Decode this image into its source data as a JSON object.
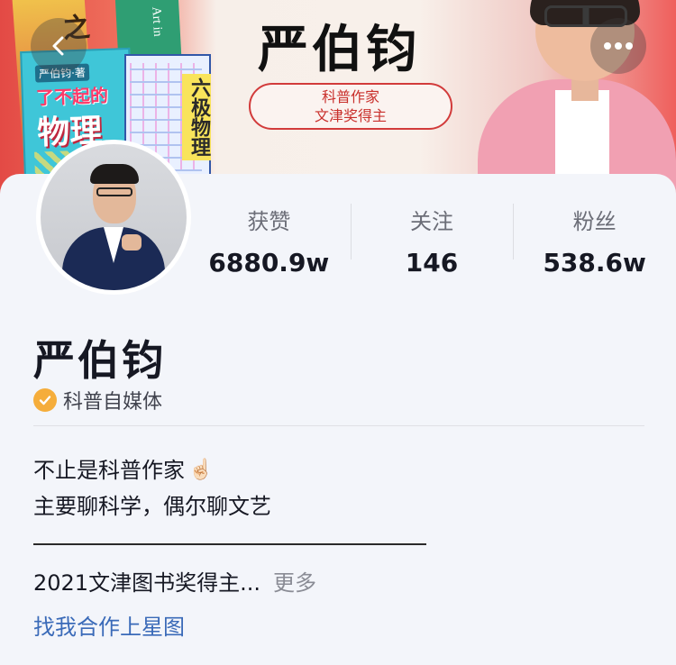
{
  "banner": {
    "name": "严伯钧",
    "tag_line1": "科普作家",
    "tag_line2": "文津奖得主",
    "books": {
      "back_title": "之美",
      "back2_title": "Art in",
      "main_series": "严伯钧·著",
      "main_title1": "了不起的",
      "main_title2": "物理",
      "six_title": "六极物理"
    }
  },
  "stats": [
    {
      "label": "获赞",
      "value": "6880.9w"
    },
    {
      "label": "关注",
      "value": "146"
    },
    {
      "label": "粉丝",
      "value": "538.6w"
    }
  ],
  "profile": {
    "name": "严伯钧",
    "verification": "科普自媒体",
    "bio_line1": "不止是科普作家",
    "bio_emoji": "☝🏻",
    "bio_line2": "主要聊科学，偶尔聊文艺",
    "award_text": "2021文津图书奖得主...",
    "more_label": "更多",
    "link_text": "找我合作上星图"
  },
  "icons": {
    "back": "chevron-left-icon",
    "more": "more-dots-icon",
    "verify": "verified-check-icon"
  },
  "colors": {
    "verify": "#f5ad3b",
    "link": "#3a6ab8",
    "tag_red": "#c9302c"
  }
}
